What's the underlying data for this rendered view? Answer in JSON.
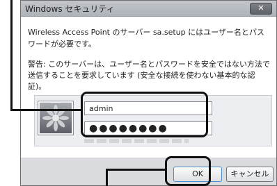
{
  "window": {
    "title": "Windows セキュリティ",
    "close_label": "✕"
  },
  "message": "Wireless Access Point のサーバー sa.setup にはユーザー名とパスワードが必要です。",
  "warning": "警告: このサーバーは、ユーザー名とパスワードを安全ではない方法で送信することを要求しています (安全な接続を使わない基本的な認証)。",
  "credentials": {
    "username_value": "admin",
    "password_value": "●●●●●●●●"
  },
  "buttons": {
    "ok_label": "OK",
    "cancel_label": "キャンセル"
  },
  "icons": {
    "user_tile": "flower-user-tile-icon",
    "close": "close-icon"
  },
  "colors": {
    "dialog_bg": "#d9dbde",
    "callout": "#111111",
    "ok_border": "#4d8ac9"
  }
}
